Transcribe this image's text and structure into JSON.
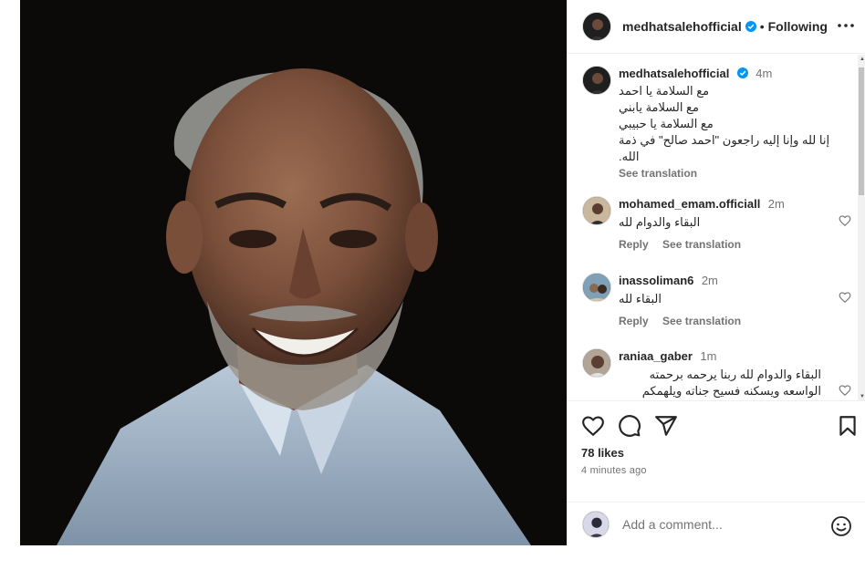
{
  "post": {
    "author": "medhatsalehofficial",
    "separator": "•",
    "follow_label": "Following",
    "caption": {
      "time": "4m",
      "lines": [
        "مع السلامة يا احمد",
        "مع السلامة يابني",
        "مع السلامة يا حبيبي",
        "إنا لله وإنا إليه راجعون \"احمد صالح\" في ذمة",
        "الله."
      ],
      "see_translation": "See translation"
    },
    "comments": [
      {
        "user": "mohamed_emam.officiall",
        "time": "2m",
        "text": "البقاء والدوام لله",
        "reply": "Reply",
        "see_translation": "See translation"
      },
      {
        "user": "inassoliman6",
        "time": "2m",
        "text": "البقاء لله",
        "reply": "Reply",
        "see_translation": "See translation"
      },
      {
        "user": "raniaa_gaber",
        "time": "1m",
        "text_line1": "البقاء والدوام لله ربنا يرحمه برحمته",
        "text_line2": "الواسعه ويسكنه فسيح جناته ويلهمكم"
      }
    ],
    "likes": "78 likes",
    "posted_ago": "4 minutes ago",
    "add_comment_placeholder": "Add a comment...",
    "colors": {
      "verified": "#0095f6",
      "text": "#262626",
      "muted": "#737373"
    }
  }
}
